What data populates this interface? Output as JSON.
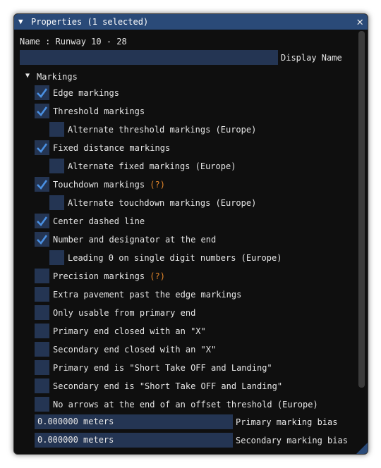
{
  "window": {
    "title": "Properties (1 selected)",
    "name_line": "Name : Runway 10 - 28",
    "display_name_value": "",
    "display_name_label": "Display Name"
  },
  "section": {
    "label": "Markings"
  },
  "rows": [
    {
      "label": "Edge markings",
      "checked": true,
      "indent": false,
      "hint": ""
    },
    {
      "label": "Threshold markings",
      "checked": true,
      "indent": false,
      "hint": ""
    },
    {
      "label": "Alternate threshold markings (Europe)",
      "checked": false,
      "indent": true,
      "hint": ""
    },
    {
      "label": "Fixed distance markings",
      "checked": true,
      "indent": false,
      "hint": ""
    },
    {
      "label": "Alternate fixed markings (Europe)",
      "checked": false,
      "indent": true,
      "hint": ""
    },
    {
      "label": "Touchdown markings",
      "checked": true,
      "indent": false,
      "hint": "(?)"
    },
    {
      "label": "Alternate touchdown markings (Europe)",
      "checked": false,
      "indent": true,
      "hint": ""
    },
    {
      "label": "Center dashed line",
      "checked": true,
      "indent": false,
      "hint": ""
    },
    {
      "label": "Number and designator at the end",
      "checked": true,
      "indent": false,
      "hint": ""
    },
    {
      "label": "Leading 0 on single digit numbers (Europe)",
      "checked": false,
      "indent": true,
      "hint": ""
    },
    {
      "label": "Precision markings",
      "checked": false,
      "indent": false,
      "hint": "(?)"
    },
    {
      "label": "Extra pavement past the edge markings",
      "checked": false,
      "indent": false,
      "hint": ""
    },
    {
      "label": "Only usable from primary end",
      "checked": false,
      "indent": false,
      "hint": ""
    },
    {
      "label": "Primary end closed with an \"X\"",
      "checked": false,
      "indent": false,
      "hint": ""
    },
    {
      "label": "Secondary end closed with an \"X\"",
      "checked": false,
      "indent": false,
      "hint": ""
    },
    {
      "label": "Primary end is \"Short Take OFF and Landing\"",
      "checked": false,
      "indent": false,
      "hint": ""
    },
    {
      "label": "Secondary end is \"Short Take OFF and Landing\"",
      "checked": false,
      "indent": false,
      "hint": ""
    },
    {
      "label": "No arrows at the end of an offset threshold (Europe)",
      "checked": false,
      "indent": false,
      "hint": ""
    }
  ],
  "bias": [
    {
      "value": "0.000000 meters",
      "label": "Primary marking bias"
    },
    {
      "value": "0.000000 meters",
      "label": "Secondary marking bias"
    }
  ],
  "colors": {
    "title_bar": "#2a4a78",
    "field_bg": "#243553",
    "check": "#4a90e2",
    "hint": "#e3862a"
  }
}
